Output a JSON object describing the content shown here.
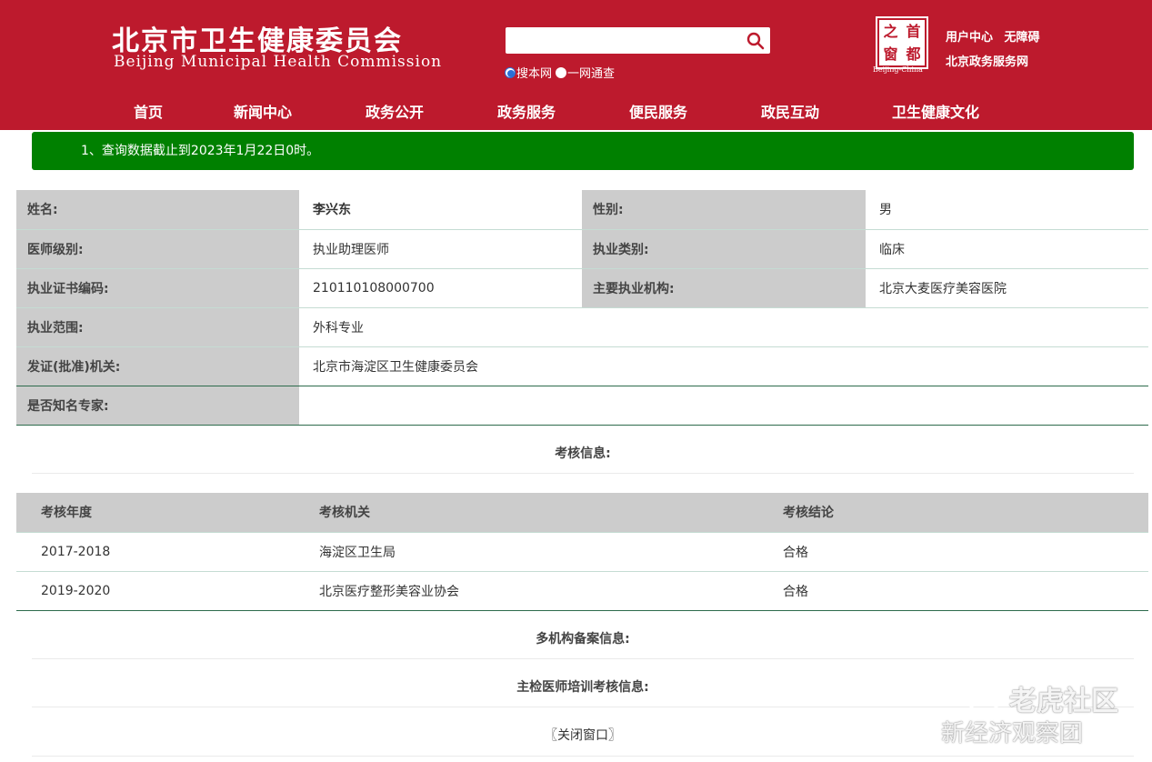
{
  "header": {
    "title": "北京市卫生健康委员会",
    "subtitle": "Beijing Municipal Health Commission",
    "search": {
      "placeholder": "",
      "value": ""
    },
    "scope_options": [
      "搜本网",
      "一网通查"
    ],
    "logo": {
      "chars": [
        "之",
        "首",
        "窗",
        "都"
      ],
      "caption": "Beijing-China"
    },
    "links": [
      "用户中心",
      "无障碍"
    ],
    "gov_service": "北京政务服务网"
  },
  "nav": [
    "首页",
    "新闻中心",
    "政务公开",
    "政务服务",
    "便民服务",
    "政民互动",
    "卫生健康文化"
  ],
  "notice": "1、查询数据截止到2023年1月22日0时。",
  "info": {
    "name_label": "姓名:",
    "name": "李兴东",
    "gender_label": "性别:",
    "gender": "男",
    "level_label": "医师级别:",
    "level": "执业助理医师",
    "category_label": "执业类别:",
    "category": "临床",
    "cert_label": "执业证书编码:",
    "cert": "210110108000700",
    "org_label": "主要执业机构:",
    "org": "北京大麦医疗美容医院",
    "scope_label": "执业范围:",
    "scope": "外科专业",
    "issuer_label": "发证(批准)机关:",
    "issuer": "北京市海淀区卫生健康委员会",
    "expert_label": "是否知名专家:",
    "expert": ""
  },
  "assessment": {
    "title": "考核信息:",
    "headers": [
      "考核年度",
      "考核机关",
      "考核结论"
    ],
    "rows": [
      [
        "2017-2018",
        "海淀区卫生局",
        "合格"
      ],
      [
        "2019-2020",
        "北京医疗整形美容业协会",
        "合格"
      ]
    ]
  },
  "multi_org_title": "多机构备案信息:",
  "training_title": "主检医师培训考核信息:",
  "close_label": "〖关闭窗口〗",
  "watermarks": {
    "top": "老虎社区",
    "bottom": "新经济观察团"
  },
  "colors": {
    "header_red": "#bd1a2d",
    "notice_green": "#008000",
    "label_gray": "#cccccc"
  }
}
